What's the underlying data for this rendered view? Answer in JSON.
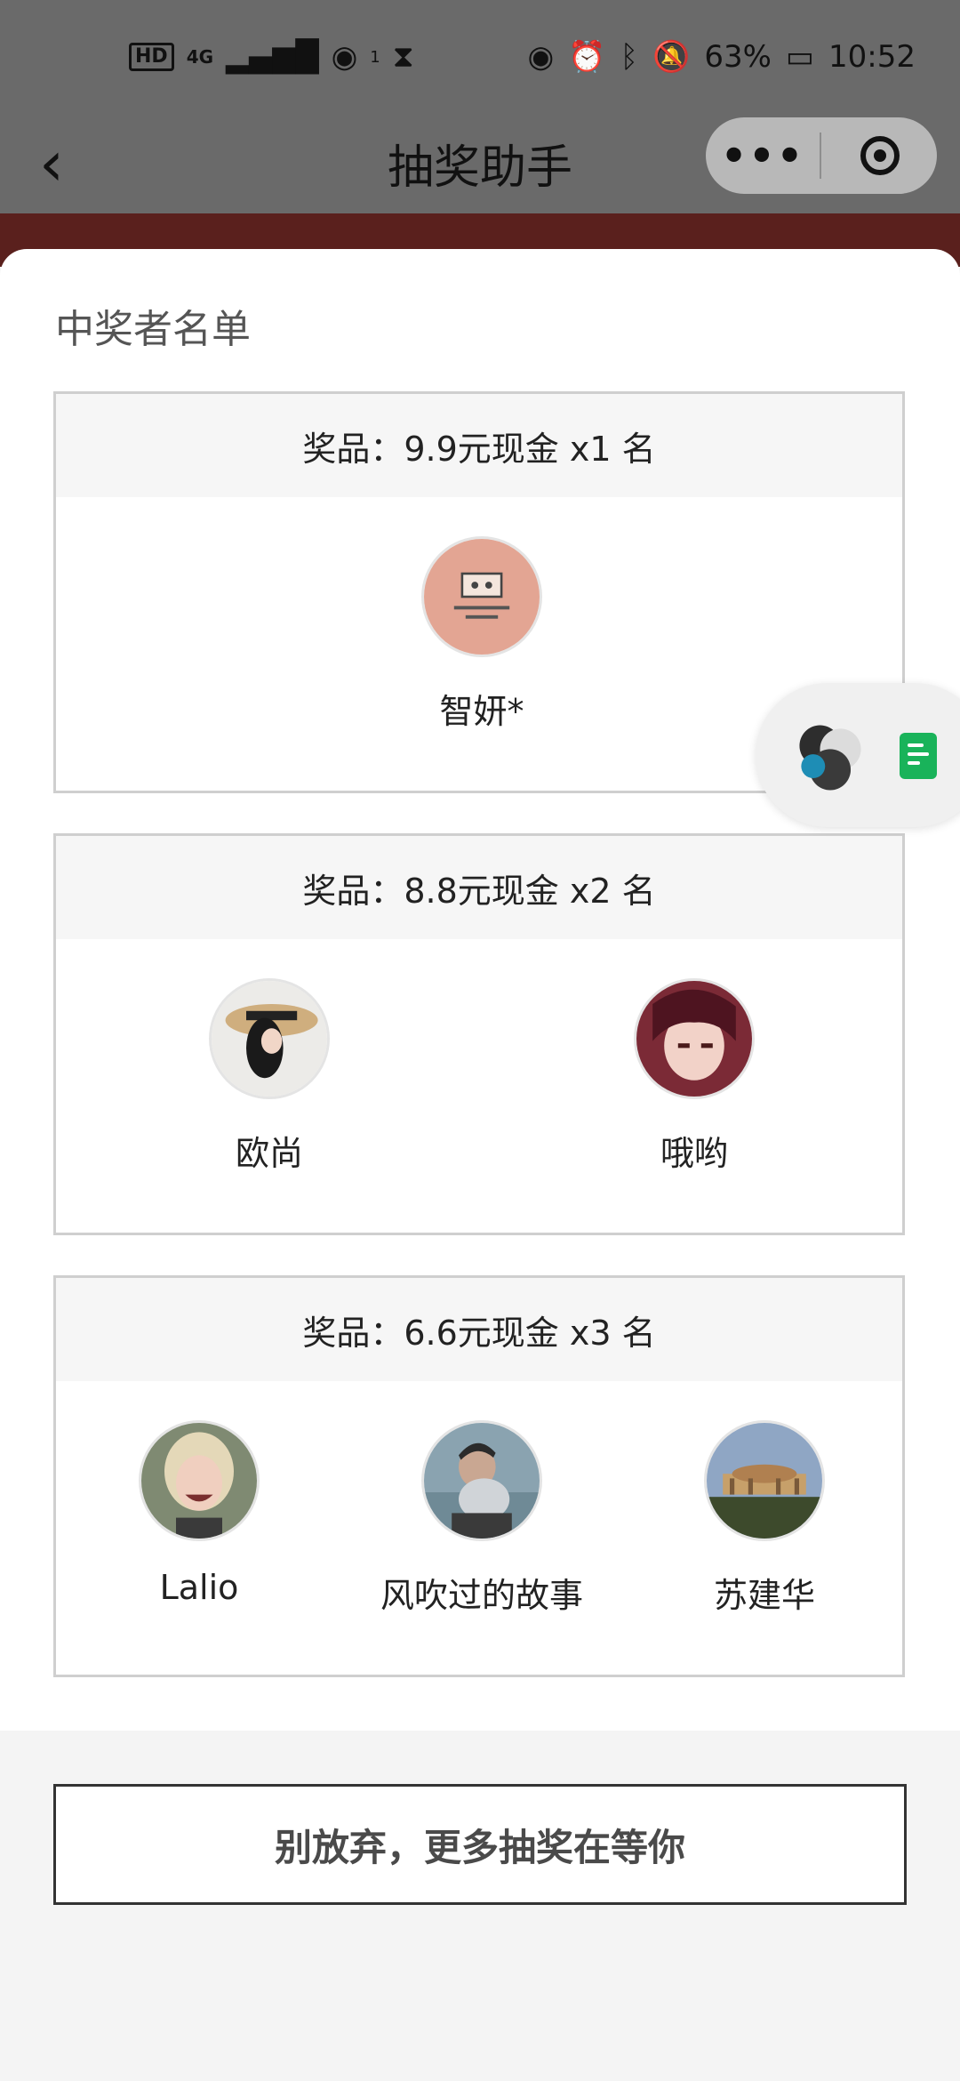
{
  "status_bar": {
    "left_chip": "HD",
    "network": "4G",
    "hotspot_count": "1",
    "battery": "63%",
    "time": "10:52"
  },
  "nav": {
    "title": "抽奖助手",
    "more_icon": "more-dots-icon",
    "close_icon": "target-circle-icon"
  },
  "sheet": {
    "title": "中奖者名单"
  },
  "prizes": [
    {
      "header": "奖品：9.9元现金 x1 名",
      "winners": [
        {
          "name": "智妍*"
        }
      ]
    },
    {
      "header": "奖品：8.8元现金 x2 名",
      "winners": [
        {
          "name": "欧尚"
        },
        {
          "name": "哦哟"
        }
      ]
    },
    {
      "header": "奖品：6.6元现金 x3 名",
      "winners": [
        {
          "name": "Lalio"
        },
        {
          "name": "风吹过的故事"
        },
        {
          "name": "苏建华"
        }
      ]
    }
  ],
  "cta": {
    "label": "别放弃，更多抽奖在等你"
  },
  "colors": {
    "overlay": "#6a6a6a",
    "brand_red": "#5a201d",
    "doc_green": "#19b35a"
  }
}
